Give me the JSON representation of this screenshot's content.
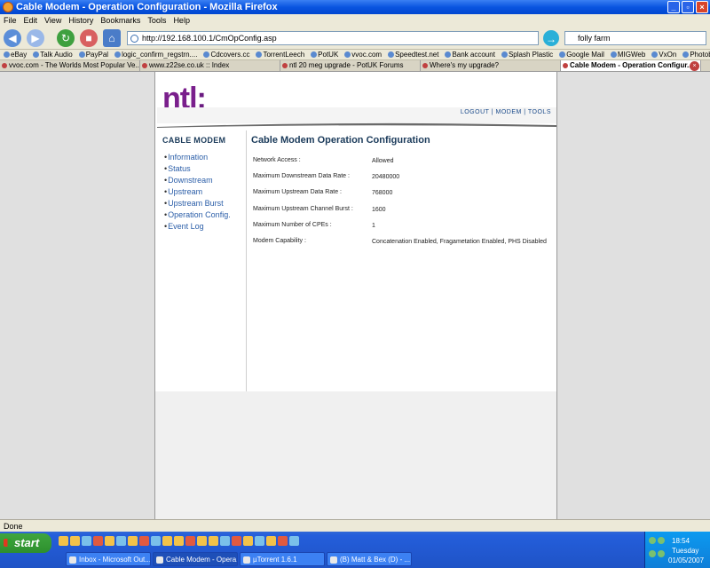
{
  "window": {
    "title": "Cable Modem - Operation Configuration - Mozilla Firefox"
  },
  "menu": [
    "File",
    "Edit",
    "View",
    "History",
    "Bookmarks",
    "Tools",
    "Help"
  ],
  "nav": {
    "url": "http://192.168.100.1/CmOpConfig.asp",
    "search_value": "folly farm"
  },
  "bookmarks": [
    "eBay",
    "Talk Audio",
    "PayPal",
    "logic_confirm_regstrn....",
    "Cdcovers.cc",
    "TorrentLeech",
    "PotUK",
    "vvoc.com",
    "Speedtest.net",
    "Bank account",
    "Splash Plastic",
    "Google Mail",
    "MIGWeb",
    "VxOn",
    "Photobucket"
  ],
  "tabs": [
    {
      "label": "vvoc.com - The Worlds Most Popular Ve...",
      "active": false
    },
    {
      "label": "www.z22se.co.uk :: Index",
      "active": false
    },
    {
      "label": "ntl 20 meg upgrade - PotUK Forums",
      "active": false
    },
    {
      "label": "Where's my upgrade?",
      "active": false
    },
    {
      "label": "Cable Modem - Operation Configur...",
      "active": true
    }
  ],
  "site": {
    "logo": "ntl",
    "logo_colon": ":",
    "top_links": "LOGOUT | MODEM | TOOLS"
  },
  "sidebar": {
    "title": "CABLE MODEM",
    "items": [
      "Information",
      "Status",
      "Downstream",
      "Upstream",
      "Upstream Burst",
      "Operation Config.",
      "Event Log"
    ]
  },
  "main": {
    "title": "Cable Modem Operation Configuration",
    "rows": [
      {
        "label": "Network Access :",
        "value": "Allowed"
      },
      {
        "label": "Maximum Downstream Data Rate :",
        "value": "20480000"
      },
      {
        "label": "Maximum Upstream Data Rate :",
        "value": "768000"
      },
      {
        "label": "Maximum Upstream Channel Burst :",
        "value": "1600"
      },
      {
        "label": "Maximum Number of CPEs :",
        "value": "1"
      },
      {
        "label": "Modem Capability :",
        "value": "Concatenation Enabled, Fragametation Enabled, PHS Disabled"
      }
    ]
  },
  "status": "Done",
  "taskbar": {
    "start": "start",
    "tasks": [
      {
        "label": "Inbox - Microsoft Out...",
        "active": false
      },
      {
        "label": "Cable Modem - Opera...",
        "active": true
      },
      {
        "label": "µTorrent 1.6.1",
        "active": false
      },
      {
        "label": "(B) Matt & Bex (D) - ...",
        "active": false
      }
    ],
    "time": "18:54",
    "day": "Tuesday",
    "date": "01/05/2007"
  }
}
